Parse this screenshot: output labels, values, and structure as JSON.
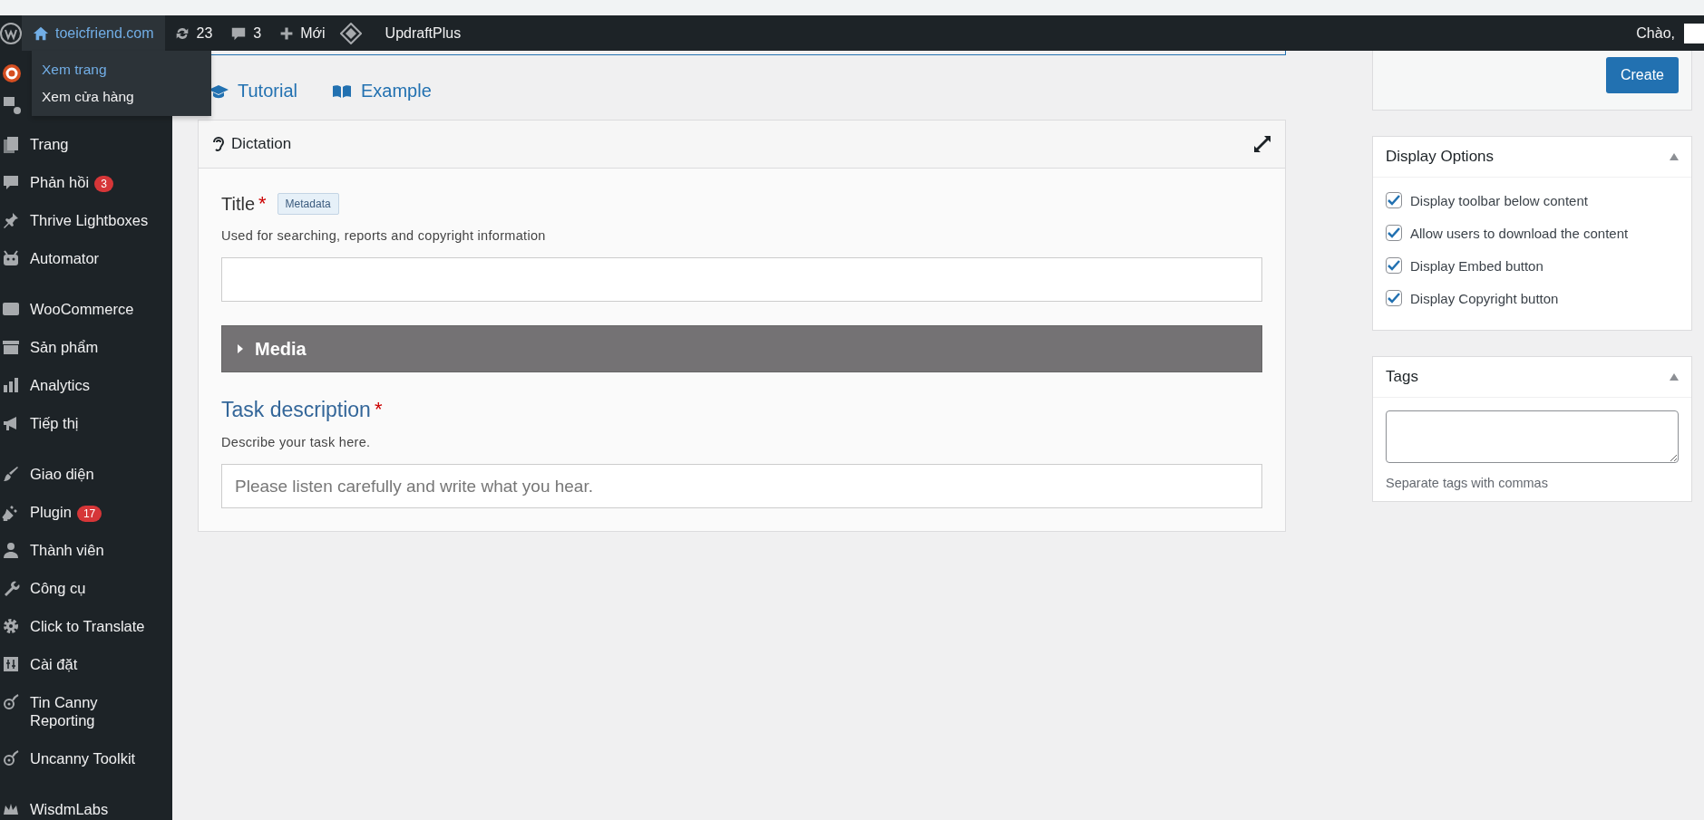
{
  "admin_bar": {
    "site": "toeicfriend.com",
    "updates": "23",
    "comments": "3",
    "new": "Mới",
    "plugin": "UpdraftPlus",
    "greeting": "Chào,"
  },
  "site_menu": [
    {
      "label": "Xem trang",
      "selected": true
    },
    {
      "label": "Xem cửa hàng",
      "selected": false
    }
  ],
  "sidebar": {
    "items": [
      {
        "kind": "item",
        "label": "Trang"
      },
      {
        "kind": "item",
        "label": "Phản hồi",
        "badge": "3"
      },
      {
        "kind": "item",
        "label": "Thrive Lightboxes"
      },
      {
        "kind": "item",
        "label": "Automator"
      },
      {
        "kind": "separator"
      },
      {
        "kind": "item",
        "label": "WooCommerce"
      },
      {
        "kind": "item",
        "label": "Sản phẩm"
      },
      {
        "kind": "item",
        "label": "Analytics"
      },
      {
        "kind": "item",
        "label": "Tiếp thị"
      },
      {
        "kind": "separator"
      },
      {
        "kind": "item",
        "label": "Giao diện"
      },
      {
        "kind": "item",
        "label": "Plugin",
        "badge": "17"
      },
      {
        "kind": "item",
        "label": "Thành viên"
      },
      {
        "kind": "item",
        "label": "Công cụ"
      },
      {
        "kind": "item",
        "label": "Click to Translate"
      },
      {
        "kind": "item",
        "label": "Cài đặt"
      },
      {
        "kind": "item",
        "label": "Tin Canny Reporting"
      },
      {
        "kind": "item",
        "label": "Uncanny Toolkit"
      },
      {
        "kind": "separator"
      },
      {
        "kind": "item",
        "label": "WisdmLabs"
      }
    ]
  },
  "links": [
    {
      "label": "Tutorial"
    },
    {
      "label": "Example"
    }
  ],
  "dictation": {
    "title": "Dictation",
    "title_field": {
      "label": "Title",
      "required_mark": "*",
      "badge": "Metadata",
      "description": "Used for searching, reports and copyright information"
    },
    "media": {
      "label": "Media",
      "expanded": false
    },
    "task_field": {
      "label": "Task description",
      "required_mark": "*",
      "description": "Describe your task here.",
      "placeholder": "Please listen carefully and write what you hear."
    }
  },
  "create_button": "Create",
  "display_options": {
    "title": "Display Options",
    "options": [
      {
        "label": "Display toolbar below content",
        "checked": true
      },
      {
        "label": "Allow users to download the content",
        "checked": true
      },
      {
        "label": "Display Embed button",
        "checked": true
      },
      {
        "label": "Display Copyright button",
        "checked": true
      }
    ]
  },
  "tags": {
    "title": "Tags",
    "hint": "Separate tags with commas"
  }
}
